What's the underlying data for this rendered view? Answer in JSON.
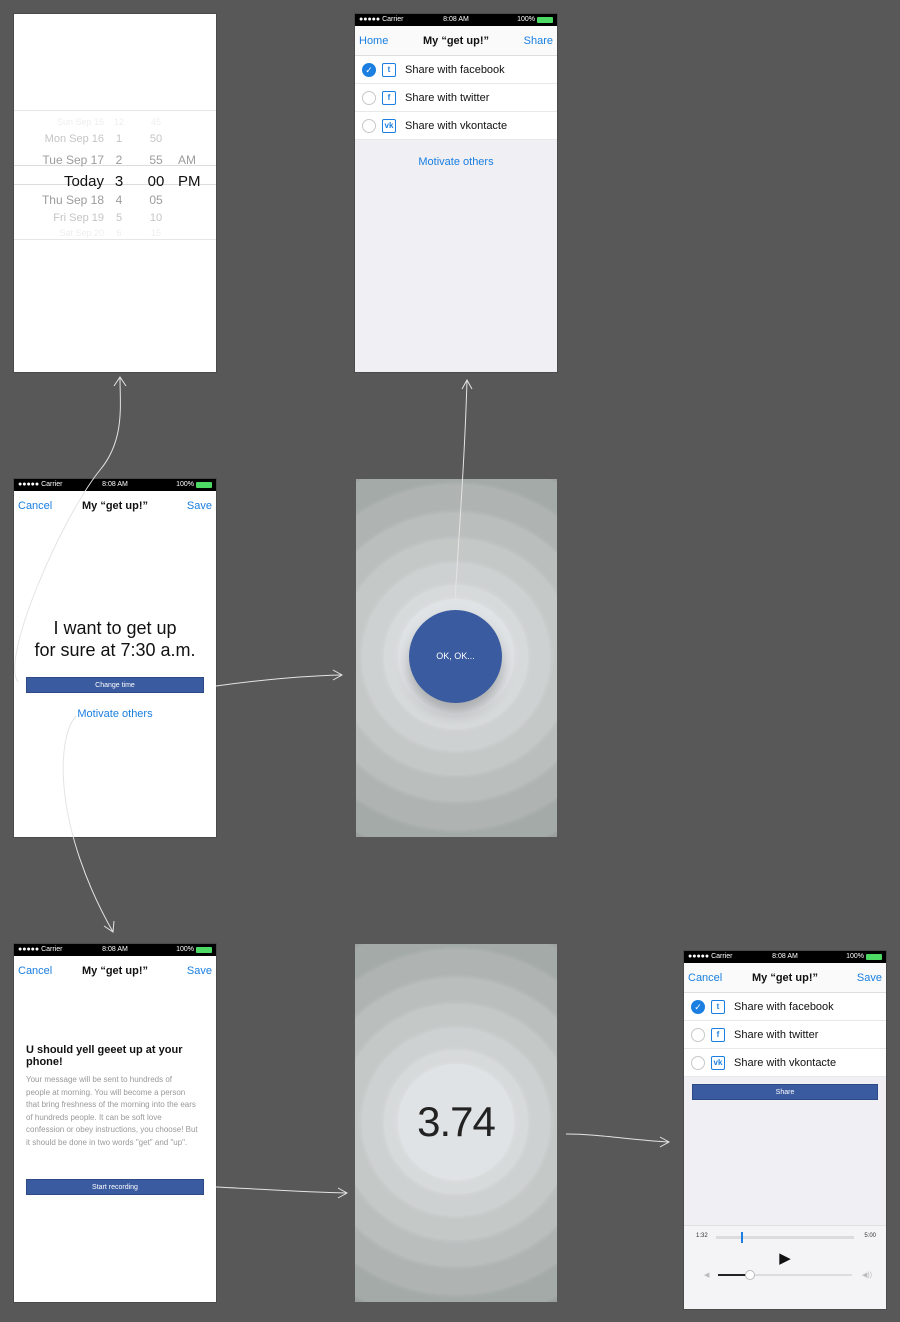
{
  "status": {
    "carrier": "●●●●● Carrier",
    "wifi": "≈",
    "time": "8:08 AM",
    "battery": "100%"
  },
  "picker": {
    "rows": [
      {
        "day": "Sun Sep 15",
        "hour": "12",
        "min": "45",
        "ampm": ""
      },
      {
        "day": "Mon Sep 16",
        "hour": "1",
        "min": "50",
        "ampm": ""
      },
      {
        "day": "Tue Sep 17",
        "hour": "2",
        "min": "55",
        "ampm": "AM"
      },
      {
        "day": "Today",
        "hour": "3",
        "min": "00",
        "ampm": "PM"
      },
      {
        "day": "Thu Sep 18",
        "hour": "4",
        "min": "05",
        "ampm": ""
      },
      {
        "day": "Fri Sep 19",
        "hour": "5",
        "min": "10",
        "ampm": ""
      },
      {
        "day": "Sat Sep 20",
        "hour": "6",
        "min": "15",
        "ampm": ""
      }
    ]
  },
  "share_screen": {
    "nav": {
      "left": "Home",
      "title": "My “get up!”",
      "right": "Share"
    },
    "options": [
      {
        "label": "Share with facebook",
        "checked": true,
        "icon": "twitter-icon",
        "glyph": "t"
      },
      {
        "label": "Share with twitter",
        "checked": false,
        "icon": "facebook-icon",
        "glyph": "f"
      },
      {
        "label": "Share with vkontacte",
        "checked": false,
        "icon": "vk-icon",
        "glyph": "vk"
      }
    ],
    "motivate": "Motivate others"
  },
  "alarm_screen": {
    "nav": {
      "left": "Cancel",
      "title": "My “get up!”",
      "right": "Save"
    },
    "headline_1": "I want to get up",
    "headline_2": "for sure at 7:30 a.m.",
    "change_time": "Change time",
    "motivate": "Motivate others"
  },
  "ok_screen": {
    "button": "OK, OK..."
  },
  "record_screen": {
    "nav": {
      "left": "Cancel",
      "title": "My “get up!”",
      "right": "Save"
    },
    "heading": "U should yell geeet up at your phone!",
    "body": "Your message will be sent to hundreds of people at morning. You will become a person that bring freshness of the morning into the ears of hundreds people. It can be soft love confession or obey instructions, you choose! But it should be done in two words \"get\" and \"up\".",
    "start": "Start recording"
  },
  "timer_screen": {
    "value": "3.74"
  },
  "final_screen": {
    "nav": {
      "left": "Cancel",
      "title": "My “get up!”",
      "right": "Save"
    },
    "options": [
      {
        "label": "Share with facebook",
        "checked": true,
        "glyph": "t"
      },
      {
        "label": "Share with twitter",
        "checked": false,
        "glyph": "f"
      },
      {
        "label": "Share with vkontacte",
        "checked": false,
        "glyph": "vk"
      }
    ],
    "share": "Share",
    "player": {
      "elapsed": "1:32",
      "total": "5:00",
      "progress": 0.18,
      "volume": 0.24,
      "play": "▶",
      "vol_low": "◀",
      "vol_high": "◀))"
    }
  },
  "colors": {
    "accent": "#1a7fe0",
    "button": "#3a5ba0",
    "background": "#585858"
  }
}
